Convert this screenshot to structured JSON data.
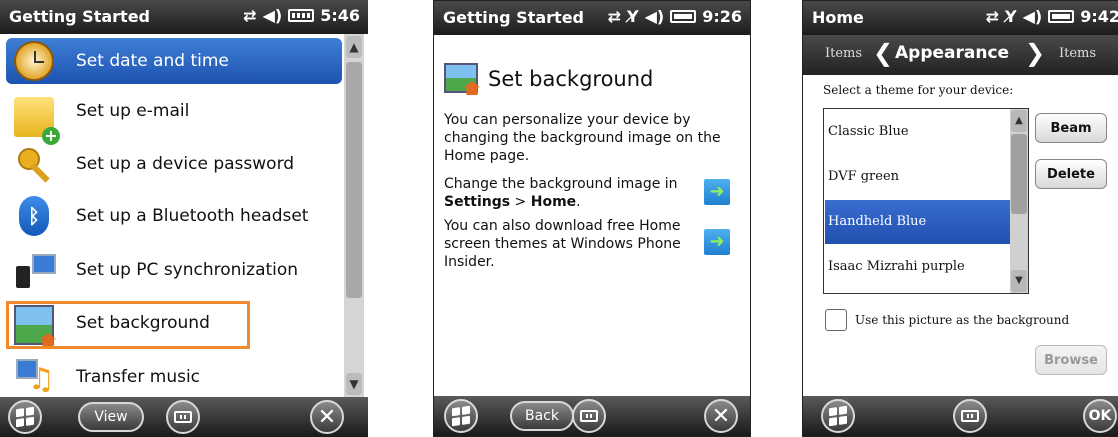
{
  "screen1": {
    "status_title": "Getting Started",
    "time": "5:46",
    "items": [
      {
        "label": "Set date and time"
      },
      {
        "label": "Set up e-mail"
      },
      {
        "label": "Set up a device password"
      },
      {
        "label": "Set up a Bluetooth headset"
      },
      {
        "label": "Set up PC synchronization"
      },
      {
        "label": "Set background"
      },
      {
        "label": "Transfer music"
      }
    ],
    "view_button": "View"
  },
  "screen2": {
    "status_title": "Getting Started",
    "time": "9:26",
    "heading": "Set background",
    "para1": "You can personalize your device by changing the background image on the Home page.",
    "para2_prefix": "Change the background image in",
    "para2_bold1": "Settings",
    "para2_sep": " > ",
    "para2_bold2": "Home",
    "para2_suffix": ".",
    "para3": "You can also download free Home screen themes at Windows Phone Insider.",
    "back_button": "Back"
  },
  "screen3": {
    "status_title": "Home",
    "time": "9:42",
    "nav_left": "Items",
    "nav_center": "Appearance",
    "nav_right": "Items",
    "prompt": "Select a theme for your device:",
    "themes": [
      "Classic Blue",
      "DVF green",
      "Handheld Blue",
      "Isaac Mizrahi purple"
    ],
    "selected_theme": "Handheld Blue",
    "beam_button": "Beam",
    "delete_button": "Delete",
    "checkbox_label": "Use this picture as the background",
    "browse_button": "Browse",
    "ok_button": "OK"
  },
  "colors": {
    "highlight_box": "#f08a2c",
    "selection_blue": "#2a5fc0"
  }
}
